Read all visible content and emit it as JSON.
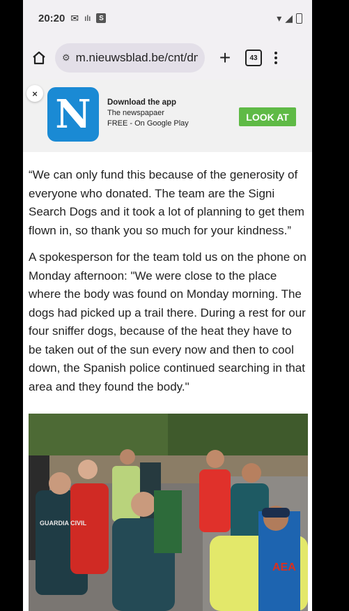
{
  "status": {
    "time": "20:20",
    "app_badge": "S"
  },
  "browser": {
    "url": "m.nieuwsblad.be/cnt/dm",
    "tab_count": "43"
  },
  "ad": {
    "close_label": "×",
    "logo_letter": "N",
    "title": "Download the app",
    "line2": "The newspapaer",
    "line3": "FREE - On Google Play",
    "cta": "LOOK AT"
  },
  "article": {
    "paragraphs": [
      "“We can only fund this because of the generosity of everyone who donated. The team are the Signi Search Dogs and it took a lot of planning to get them flown in, so thank you so much for your kindness.”",
      "A spokesperson for the team told us on the phone on Monday afternoon: \"We were close to the place where the body was found on Monday morning. The dogs had picked up a trail there. During a rest for our four sniffer dogs, because of the heat they have to be taken out of the sun every now and then to cool down, the Spanish police continued searching in that area and they found the body.\""
    ]
  },
  "photo": {
    "vest_text_1": "GUARDIA CIVIL",
    "vest_text_2": "AEA"
  },
  "colors": {
    "accent_blue": "#1a8ad4",
    "cta_green": "#5fba46"
  }
}
